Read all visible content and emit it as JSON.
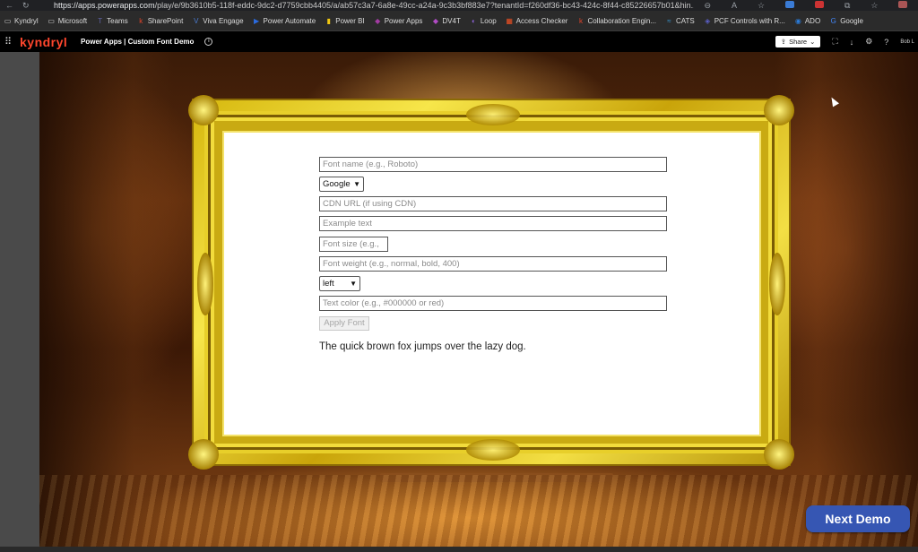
{
  "browser": {
    "url_host": "https://apps.powerapps.com",
    "url_rest": "/play/e/9b3610b5-118f-eddc-9dc2-d7759cbb4405/a/ab57c3a7-6a8e-49cc-a24a-9c3b3bf883e7?tenantId=f260df36-bc43-424c-8f44-c85226657b01&hin...",
    "nav_icons": [
      "back-icon",
      "refresh-icon"
    ]
  },
  "bookmarks": [
    {
      "label": "Kyndryl",
      "icon": "folder-icon",
      "color": "#dcdcdc"
    },
    {
      "label": "Microsoft",
      "icon": "folder-icon",
      "color": "#dcdcdc"
    },
    {
      "label": "Teams",
      "icon": "teams-icon",
      "color": "#6264a7"
    },
    {
      "label": "SharePoint",
      "icon": "k-icon",
      "color": "#e0442a"
    },
    {
      "label": "Viva Engage",
      "icon": "viva-icon",
      "color": "#4a7bd0"
    },
    {
      "label": "Power Automate",
      "icon": "power-automate-icon",
      "color": "#2b6be0"
    },
    {
      "label": "Power BI",
      "icon": "power-bi-icon",
      "color": "#f2c811"
    },
    {
      "label": "Power Apps",
      "icon": "power-apps-icon",
      "color": "#a33ba3"
    },
    {
      "label": "DV4T",
      "icon": "dv4t-icon",
      "color": "#b04bc4"
    },
    {
      "label": "Loop",
      "icon": "loop-icon",
      "color": "#8860d0"
    },
    {
      "label": "Access Checker",
      "icon": "microsoft-icon",
      "color": "#f25022"
    },
    {
      "label": "Collaboration Engin...",
      "icon": "k-icon",
      "color": "#e0442a"
    },
    {
      "label": "CATS",
      "icon": "cats-icon",
      "color": "#3aa0e0"
    },
    {
      "label": "PCF Controls with R...",
      "icon": "pcf-icon",
      "color": "#5b5fc7"
    },
    {
      "label": "ADO",
      "icon": "ado-icon",
      "color": "#2a7ad6"
    },
    {
      "label": "Google",
      "icon": "google-icon",
      "color": "#4285f4"
    }
  ],
  "app_header": {
    "brand": "kyndryl",
    "title": "Power Apps  |  Custom Font Demo",
    "share_label": "Share",
    "user": "Bob L"
  },
  "form": {
    "font_name_placeholder": "Font name (e.g., Roboto)",
    "source_selected": "Google",
    "cdn_url_placeholder": "CDN URL (if using CDN)",
    "example_text_placeholder": "Example text",
    "font_size_placeholder": "Font size (e.g.,",
    "font_weight_placeholder": "Font weight (e.g., normal, bold, 400)",
    "align_selected": "left",
    "text_color_placeholder": "Text color (e.g., #000000 or red)",
    "apply_label": "Apply Font",
    "preview_text": "The quick brown fox jumps over the lazy dog."
  },
  "next_button": "Next Demo",
  "colors": {
    "brand_red": "#ff462d",
    "next_button": "#3656b3",
    "frame_gold": "#e8cf2a"
  }
}
